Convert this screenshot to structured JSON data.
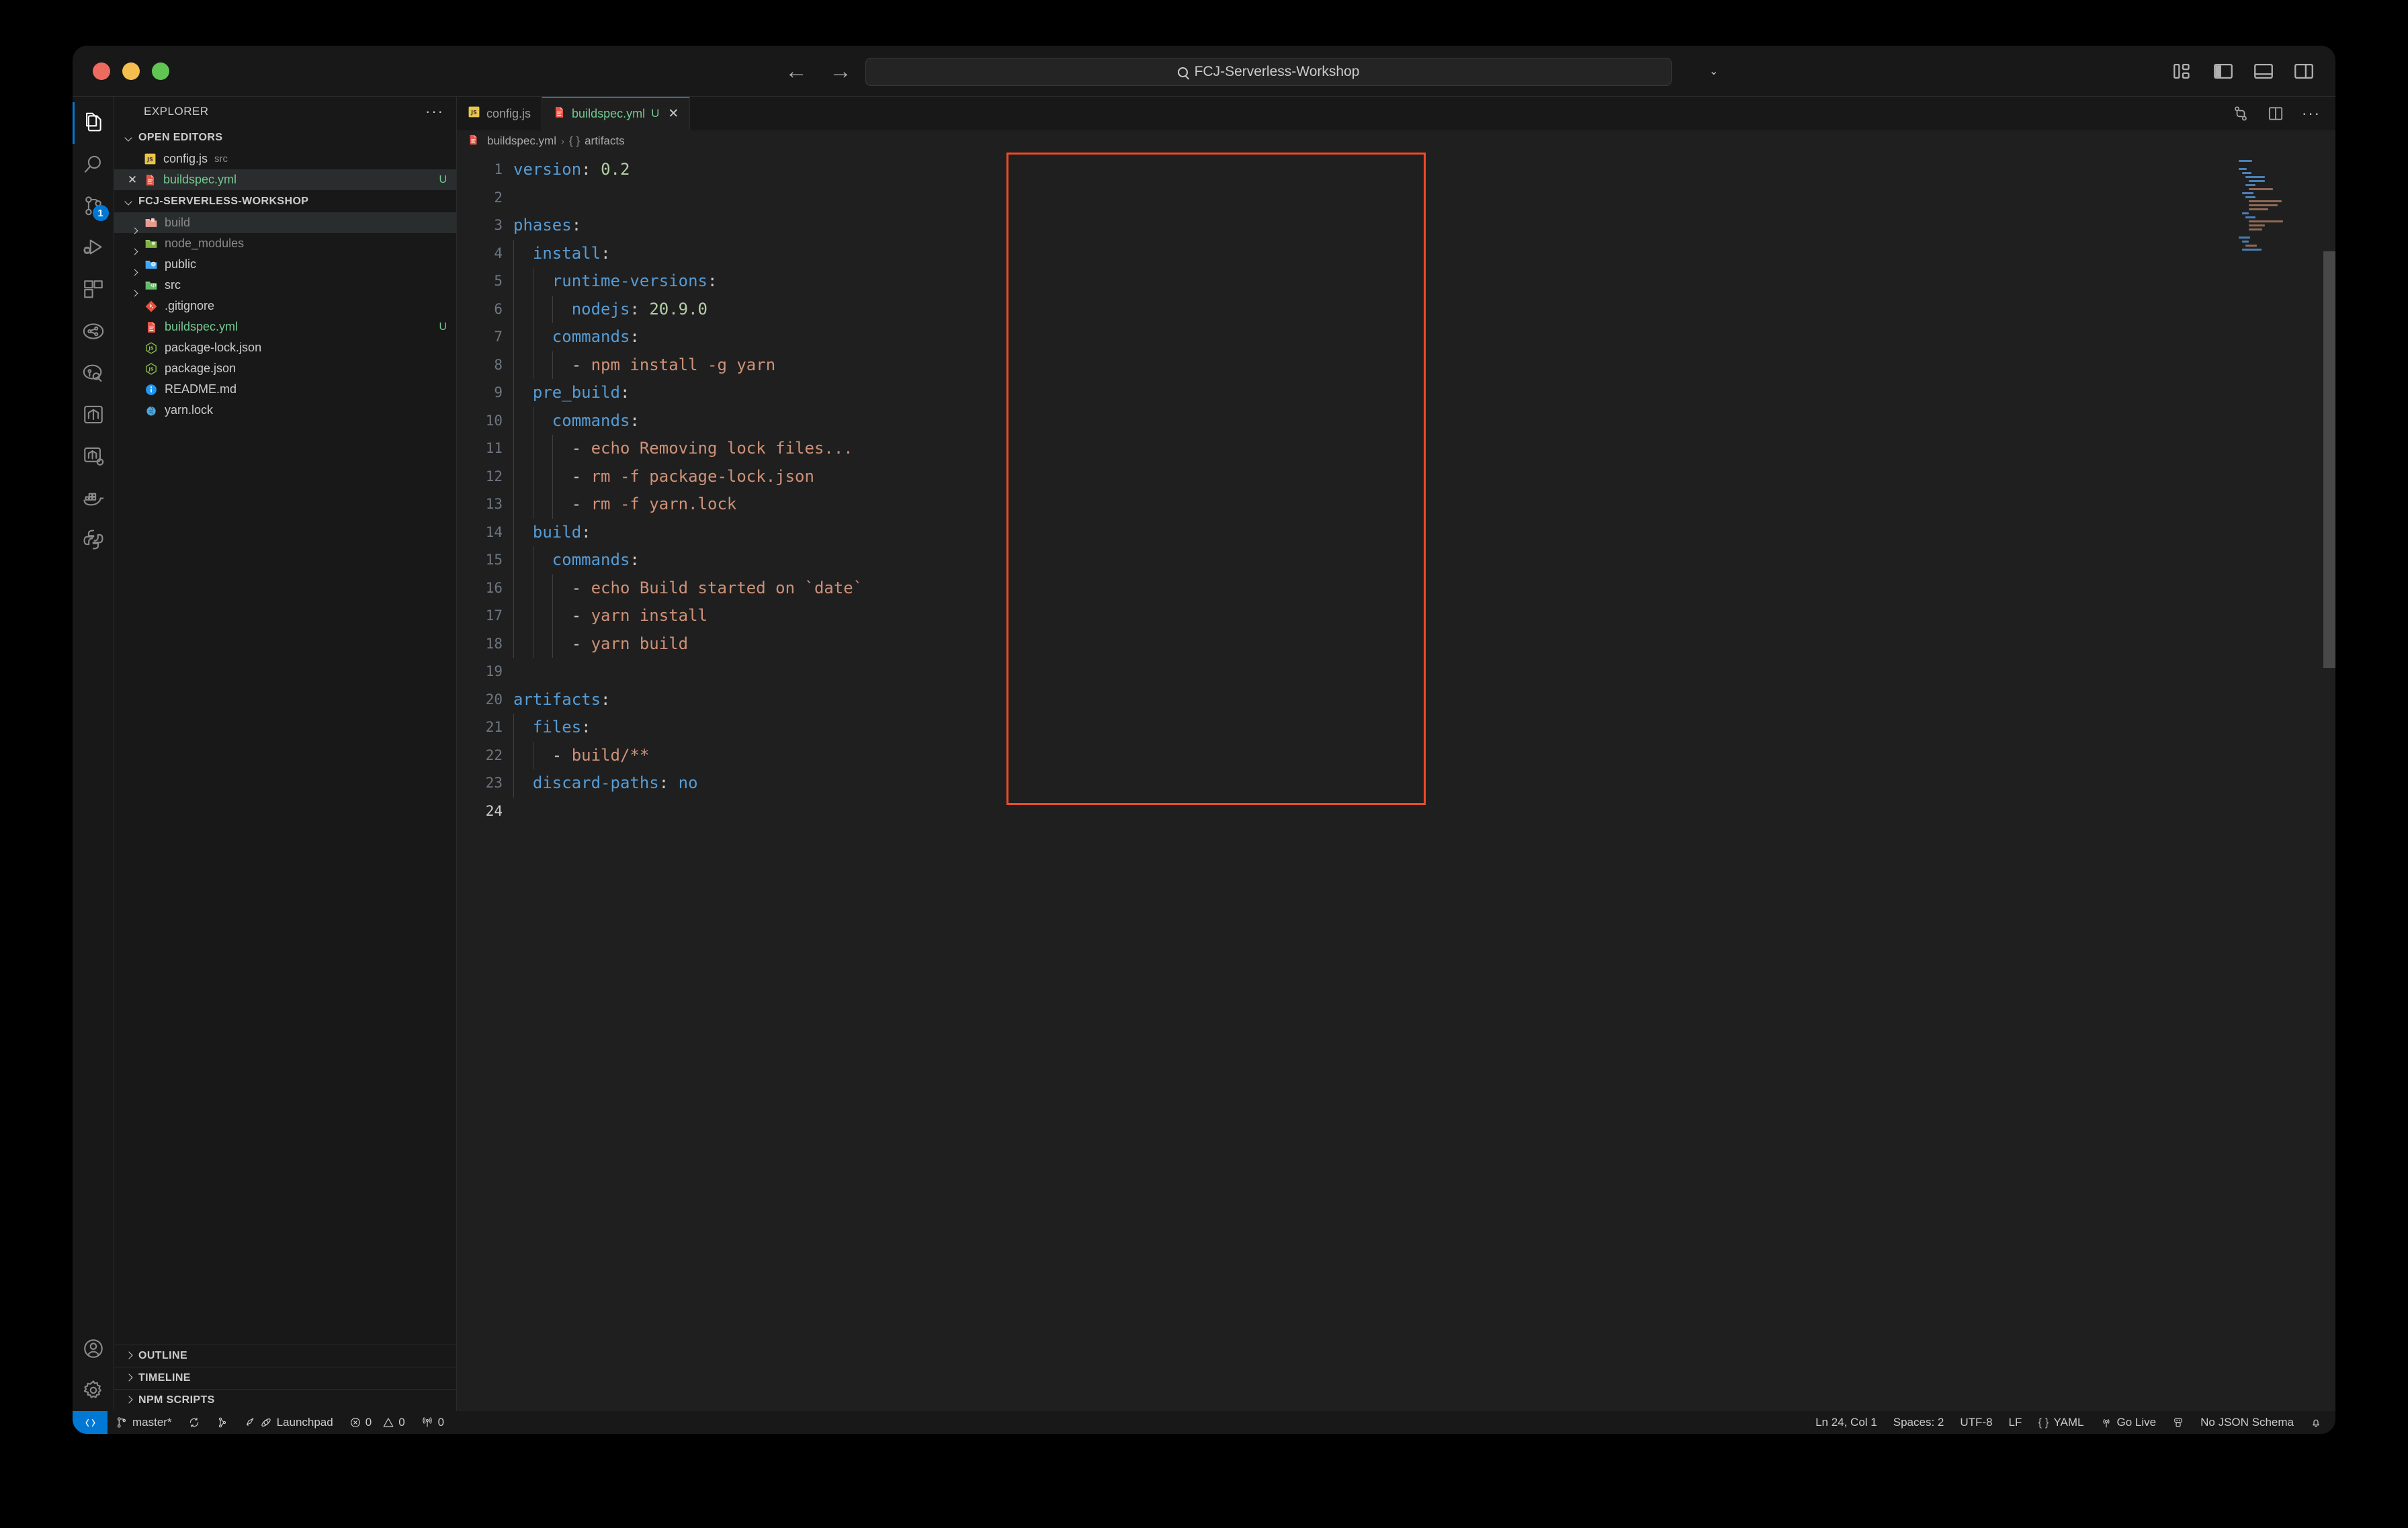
{
  "window": {
    "title": "FCJ-Serverless-Workshop",
    "search_placeholder": "FCJ-Serverless-Workshop"
  },
  "titlebar": {
    "back_icon": "←",
    "forward_icon": "→",
    "search_icon": "search-icon",
    "remote_icon": "remote-window-icon",
    "chevron": "⌄",
    "layout_icons": [
      "customize-layout-icon",
      "toggle-primary-sidebar-icon",
      "toggle-panel-icon",
      "toggle-secondary-sidebar-icon"
    ]
  },
  "activitybar": {
    "items": [
      {
        "name": "explorer",
        "label": "Explorer",
        "active": true
      },
      {
        "name": "search",
        "label": "Search",
        "active": false
      },
      {
        "name": "source-control",
        "label": "Source Control",
        "active": false,
        "badge": "1"
      },
      {
        "name": "run-and-debug",
        "label": "Run and Debug",
        "active": false
      },
      {
        "name": "extensions",
        "label": "Extensions",
        "active": false
      },
      {
        "name": "aws-toolkit",
        "label": "AWS Toolkit",
        "active": false
      },
      {
        "name": "aws-explorer",
        "label": "AWS Explorer",
        "active": false
      },
      {
        "name": "terraform",
        "label": "Terraform",
        "active": false
      },
      {
        "name": "terraform-cloud",
        "label": "Terraform Cloud",
        "active": false
      },
      {
        "name": "docker",
        "label": "Docker",
        "active": false
      },
      {
        "name": "python",
        "label": "Python",
        "active": false
      }
    ],
    "bottom": [
      {
        "name": "accounts",
        "label": "Accounts"
      },
      {
        "name": "manage-settings",
        "label": "Manage"
      }
    ]
  },
  "sidebar": {
    "header": "EXPLORER",
    "more_actions": "···",
    "open_editors": {
      "title": "OPEN EDITORS",
      "items": [
        {
          "name": "config.js",
          "sub": "src",
          "icon": "js-file-icon",
          "status": "",
          "selected": false,
          "show_close": false
        },
        {
          "name": "buildspec.yml",
          "sub": "",
          "icon": "yaml-file-icon",
          "status": "U",
          "selected": true,
          "show_close": true
        }
      ]
    },
    "project": {
      "title": "FCJ-SERVERLESS-WORKSHOP",
      "items": [
        {
          "name": "build",
          "icon": "folder-build-icon",
          "type": "folder",
          "status": "",
          "dim": true,
          "selected": true
        },
        {
          "name": "node_modules",
          "icon": "folder-node-icon",
          "type": "folder",
          "status": "",
          "dim": true,
          "selected": false
        },
        {
          "name": "public",
          "icon": "folder-public-icon",
          "type": "folder",
          "status": "",
          "dim": false,
          "selected": false
        },
        {
          "name": "src",
          "icon": "folder-src-icon",
          "type": "folder",
          "status": "",
          "dim": false,
          "selected": false
        },
        {
          "name": ".gitignore",
          "icon": "git-file-icon",
          "type": "file",
          "status": "",
          "dim": false,
          "selected": false
        },
        {
          "name": "buildspec.yml",
          "icon": "yaml-file-icon",
          "type": "file",
          "status": "U",
          "dim": false,
          "selected": false,
          "green": true
        },
        {
          "name": "package-lock.json",
          "icon": "npm-file-icon",
          "type": "file",
          "status": "",
          "dim": false,
          "selected": false
        },
        {
          "name": "package.json",
          "icon": "npm-file-icon",
          "type": "file",
          "status": "",
          "dim": false,
          "selected": false
        },
        {
          "name": "README.md",
          "icon": "readme-file-icon",
          "type": "file",
          "status": "",
          "dim": false,
          "selected": false
        },
        {
          "name": "yarn.lock",
          "icon": "yarn-file-icon",
          "type": "file",
          "status": "",
          "dim": false,
          "selected": false
        }
      ]
    },
    "bottom_sections": [
      "OUTLINE",
      "TIMELINE",
      "NPM SCRIPTS"
    ]
  },
  "tabs": [
    {
      "label": "config.js",
      "icon": "js-file-icon",
      "active": false,
      "modified": "",
      "closable": false
    },
    {
      "label": "buildspec.yml",
      "icon": "yaml-file-icon",
      "active": true,
      "modified": "U",
      "closable": true
    }
  ],
  "tab_actions": [
    "split-editor-icon",
    "more-actions-icon",
    "compare-changes-icon"
  ],
  "breadcrumb": {
    "file": "buildspec.yml",
    "separator": "›",
    "symbol_icon": "{ }",
    "symbol": "artifacts"
  },
  "editor": {
    "language": "yaml",
    "total_lines": 24,
    "cursor_line": 24,
    "lines": [
      {
        "n": 1,
        "indent": 0,
        "tokens": [
          {
            "t": "version",
            "c": "k"
          },
          {
            "t": ":",
            "c": "p"
          },
          {
            "t": " ",
            "c": "p"
          },
          {
            "t": "0.2",
            "c": "n"
          }
        ]
      },
      {
        "n": 2,
        "indent": 0,
        "tokens": []
      },
      {
        "n": 3,
        "indent": 0,
        "tokens": [
          {
            "t": "phases",
            "c": "k"
          },
          {
            "t": ":",
            "c": "p"
          }
        ]
      },
      {
        "n": 4,
        "indent": 1,
        "tokens": [
          {
            "t": "install",
            "c": "k"
          },
          {
            "t": ":",
            "c": "p"
          }
        ]
      },
      {
        "n": 5,
        "indent": 2,
        "tokens": [
          {
            "t": "runtime-versions",
            "c": "k"
          },
          {
            "t": ":",
            "c": "p"
          }
        ]
      },
      {
        "n": 6,
        "indent": 3,
        "tokens": [
          {
            "t": "nodejs",
            "c": "k"
          },
          {
            "t": ":",
            "c": "p"
          },
          {
            "t": " ",
            "c": "p"
          },
          {
            "t": "20.9.0",
            "c": "n"
          }
        ]
      },
      {
        "n": 7,
        "indent": 2,
        "tokens": [
          {
            "t": "commands",
            "c": "k"
          },
          {
            "t": ":",
            "c": "p"
          }
        ]
      },
      {
        "n": 8,
        "indent": 3,
        "tokens": [
          {
            "t": "- ",
            "c": "d"
          },
          {
            "t": "npm install -g yarn",
            "c": "s"
          }
        ]
      },
      {
        "n": 9,
        "indent": 1,
        "tokens": [
          {
            "t": "pre_build",
            "c": "k"
          },
          {
            "t": ":",
            "c": "p"
          }
        ]
      },
      {
        "n": 10,
        "indent": 2,
        "tokens": [
          {
            "t": "commands",
            "c": "k"
          },
          {
            "t": ":",
            "c": "p"
          }
        ]
      },
      {
        "n": 11,
        "indent": 3,
        "tokens": [
          {
            "t": "- ",
            "c": "d"
          },
          {
            "t": "echo Removing lock files...",
            "c": "s"
          }
        ]
      },
      {
        "n": 12,
        "indent": 3,
        "tokens": [
          {
            "t": "- ",
            "c": "d"
          },
          {
            "t": "rm -f package-lock.json",
            "c": "s"
          }
        ]
      },
      {
        "n": 13,
        "indent": 3,
        "tokens": [
          {
            "t": "- ",
            "c": "d"
          },
          {
            "t": "rm -f yarn.lock",
            "c": "s"
          }
        ]
      },
      {
        "n": 14,
        "indent": 1,
        "tokens": [
          {
            "t": "build",
            "c": "k"
          },
          {
            "t": ":",
            "c": "p"
          }
        ]
      },
      {
        "n": 15,
        "indent": 2,
        "tokens": [
          {
            "t": "commands",
            "c": "k"
          },
          {
            "t": ":",
            "c": "p"
          }
        ]
      },
      {
        "n": 16,
        "indent": 3,
        "tokens": [
          {
            "t": "- ",
            "c": "d"
          },
          {
            "t": "echo Build started on `date`",
            "c": "s"
          }
        ]
      },
      {
        "n": 17,
        "indent": 3,
        "tokens": [
          {
            "t": "- ",
            "c": "d"
          },
          {
            "t": "yarn install",
            "c": "s"
          }
        ]
      },
      {
        "n": 18,
        "indent": 3,
        "tokens": [
          {
            "t": "- ",
            "c": "d"
          },
          {
            "t": "yarn build",
            "c": "s"
          }
        ]
      },
      {
        "n": 19,
        "indent": 0,
        "tokens": []
      },
      {
        "n": 20,
        "indent": 0,
        "tokens": [
          {
            "t": "artifacts",
            "c": "k"
          },
          {
            "t": ":",
            "c": "p"
          }
        ]
      },
      {
        "n": 21,
        "indent": 1,
        "tokens": [
          {
            "t": "files",
            "c": "k"
          },
          {
            "t": ":",
            "c": "p"
          }
        ]
      },
      {
        "n": 22,
        "indent": 2,
        "tokens": [
          {
            "t": "- ",
            "c": "d"
          },
          {
            "t": "build/**",
            "c": "s"
          }
        ]
      },
      {
        "n": 23,
        "indent": 1,
        "tokens": [
          {
            "t": "discard-paths",
            "c": "k"
          },
          {
            "t": ":",
            "c": "p"
          },
          {
            "t": " ",
            "c": "p"
          },
          {
            "t": "no",
            "c": "k"
          }
        ]
      },
      {
        "n": 24,
        "indent": 0,
        "tokens": []
      }
    ]
  },
  "annotation": {
    "type": "highlight-rectangle",
    "color": "#f04a28"
  },
  "statusbar": {
    "left": [
      {
        "name": "remote-indicator",
        "label": "",
        "icon": "remote-icon"
      },
      {
        "name": "git-branch",
        "label": "master*",
        "icon": "source-control-icon"
      },
      {
        "name": "sync-changes",
        "label": "",
        "icon": "sync-icon"
      },
      {
        "name": "git-graph",
        "label": "",
        "icon": "git-graph-icon"
      },
      {
        "name": "launchpad",
        "label": "Launchpad",
        "icon": "rocket-icon"
      },
      {
        "name": "problems-errors",
        "label": "0",
        "icon": "error-icon"
      },
      {
        "name": "problems-warnings",
        "label": "0",
        "icon": "warning-icon"
      },
      {
        "name": "ports",
        "label": "0",
        "icon": "radio-tower-icon"
      }
    ],
    "right": [
      {
        "name": "editor-position",
        "label": "Ln 24, Col 1"
      },
      {
        "name": "indentation",
        "label": "Spaces: 2"
      },
      {
        "name": "encoding",
        "label": "UTF-8"
      },
      {
        "name": "eol",
        "label": "LF"
      },
      {
        "name": "language-mode",
        "label": "YAML",
        "icon": "braces-icon"
      },
      {
        "name": "go-live",
        "label": "Go Live",
        "icon": "broadcast-icon"
      },
      {
        "name": "remote-account",
        "label": "",
        "icon": "remote-account-icon"
      },
      {
        "name": "json-schema",
        "label": "No JSON Schema"
      },
      {
        "name": "notifications",
        "label": "",
        "icon": "bell-icon"
      }
    ]
  },
  "colors": {
    "accent": "#0078d4",
    "annotation": "#f04a28",
    "modified": "#73c991",
    "background": "#1f1f1f",
    "chrome": "#181818"
  }
}
